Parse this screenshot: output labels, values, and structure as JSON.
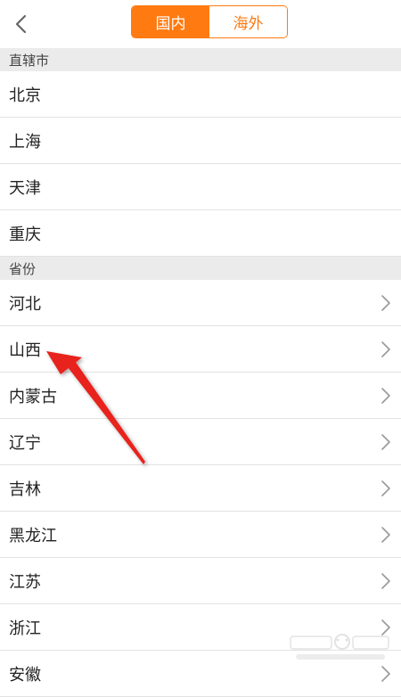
{
  "tabs": [
    {
      "label": "国内",
      "active": true
    },
    {
      "label": "海外",
      "active": false
    }
  ],
  "sections": [
    {
      "title": "直辖市",
      "items": [
        "北京",
        "上海",
        "天津",
        "重庆"
      ],
      "chevron": false
    },
    {
      "title": "省份",
      "items": [
        "河北",
        "山西",
        "内蒙古",
        "辽宁",
        "吉林",
        "黑龙江",
        "江苏",
        "浙江",
        "安徽"
      ],
      "chevron": true
    }
  ],
  "colors": {
    "accent": "#ff7a10",
    "section_bg": "#ebebeb",
    "annotation_arrow": "#e8201c"
  },
  "icons": {
    "back": "chevron-left-icon",
    "row": "chevron-right-icon"
  }
}
